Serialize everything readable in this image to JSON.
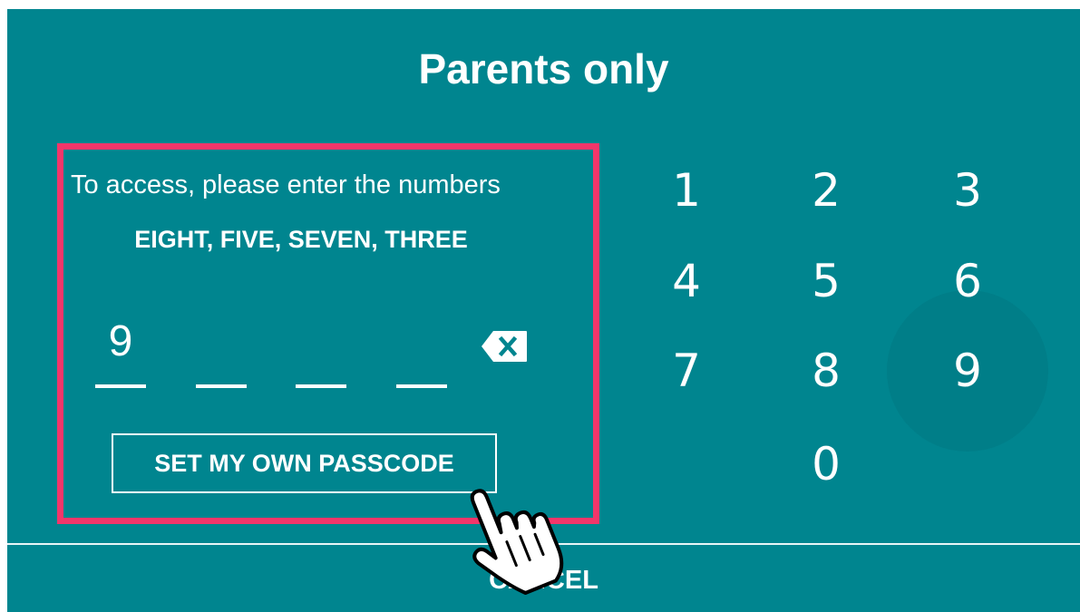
{
  "dialog": {
    "title": "Parents only",
    "instruction": "To access, please enter the numbers",
    "code_words": "EIGHT, FIVE, SEVEN, THREE",
    "entered_digits": [
      "9",
      "",
      "",
      ""
    ],
    "set_own_passcode_label": "SET MY OWN PASSCODE",
    "cancel_label": "CANCEL"
  },
  "keypad": {
    "keys": [
      "1",
      "2",
      "3",
      "4",
      "5",
      "6",
      "7",
      "8",
      "9",
      "0"
    ]
  },
  "icons": {
    "backspace": "backspace-icon",
    "cursor": "hand-pointer-icon"
  },
  "colors": {
    "background": "#00858f",
    "highlight": "#f2366a",
    "text": "#ffffff"
  }
}
